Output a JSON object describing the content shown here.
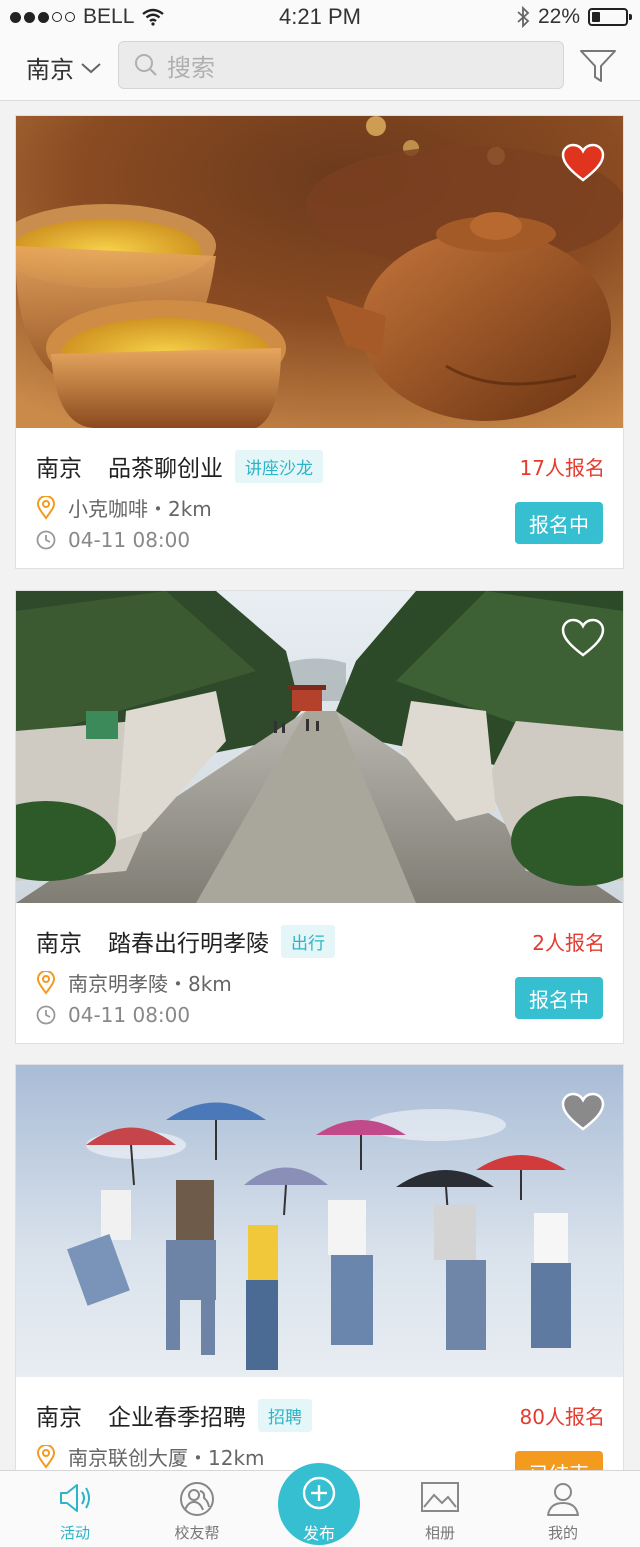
{
  "status_bar": {
    "carrier": "BELL",
    "time": "4:21 PM",
    "battery": "22%"
  },
  "header": {
    "city": "南京",
    "search_placeholder": "搜索"
  },
  "events": [
    {
      "city": "南京",
      "title": "品茶聊创业",
      "tag": "讲座沙龙",
      "count": "17人报名",
      "location": "小克咖啡・2km",
      "datetime": "04-11   08:00",
      "status": "报名中",
      "favorited": true
    },
    {
      "city": "南京",
      "title": "踏春出行明孝陵",
      "tag": "出行",
      "count": "2人报名",
      "location": "南京明孝陵・8km",
      "datetime": "04-11   08:00",
      "status": "报名中",
      "favorited": false
    },
    {
      "city": "南京",
      "title": "企业春季招聘",
      "tag": "招聘",
      "count": "80人报名",
      "location": "南京联创大厦・12km",
      "status": "已结束",
      "favorited": false
    }
  ],
  "tabbar": {
    "activity": "活动",
    "alumni": "校友帮",
    "publish": "发布",
    "album": "相册",
    "mine": "我的"
  },
  "colors": {
    "accent": "#35bfd0",
    "count": "#e43b2f",
    "ended": "#f39a1f",
    "heart_active": "#e0341f"
  }
}
